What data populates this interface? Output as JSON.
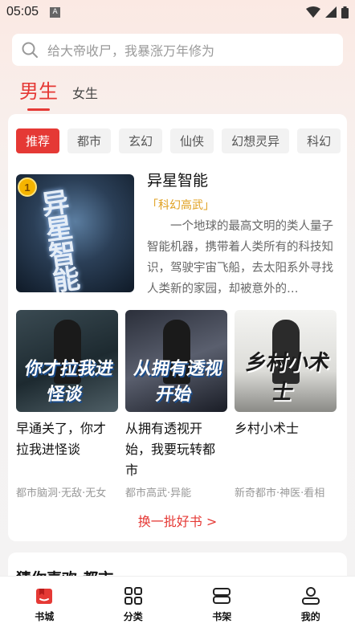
{
  "status_bar": {
    "time": "05:05",
    "notification_letter": "A"
  },
  "search": {
    "placeholder": "给大帝收尸，我暴涨万年修为"
  },
  "gender_tabs": {
    "male": "男生",
    "female": "女生"
  },
  "categories": [
    "推荐",
    "都市",
    "玄幻",
    "仙侠",
    "幻想灵异",
    "科幻"
  ],
  "featured": {
    "rank": "1",
    "cover_text": "异星智能",
    "title": "异星智能",
    "genre": "「科幻高武」",
    "description": "一个地球的最高文明的类人量子智能机器，携带着人类所有的科技知识，驾驶宇宙飞船，去太阳系外寻找人类新的家园，却被意外的…"
  },
  "books": [
    {
      "cover_text": "你才拉我进怪谈",
      "title": "早通关了，你才拉我进怪谈",
      "tags": "都市脑洞·无敌·无女"
    },
    {
      "cover_text": "从拥有透视开始",
      "title": "从拥有透视开始，我要玩转都市",
      "tags": "都市高武·异能"
    },
    {
      "cover_text": "乡村小术士",
      "title": "乡村小术士",
      "tags": "新奇都市·神医·看相"
    }
  ],
  "refresh": "换一批好书 >",
  "next_section": {
    "title": "猜你喜欢·都市"
  },
  "bottom_nav": [
    {
      "label": "书城",
      "icon": "bookstore-icon",
      "active": true
    },
    {
      "label": "分类",
      "icon": "category-grid-icon",
      "active": false
    },
    {
      "label": "书架",
      "icon": "bookshelf-icon",
      "active": false
    },
    {
      "label": "我的",
      "icon": "profile-icon",
      "active": false
    }
  ],
  "colors": {
    "accent": "#e53935",
    "genre": "#e0a020",
    "badge": "#f5b400"
  }
}
